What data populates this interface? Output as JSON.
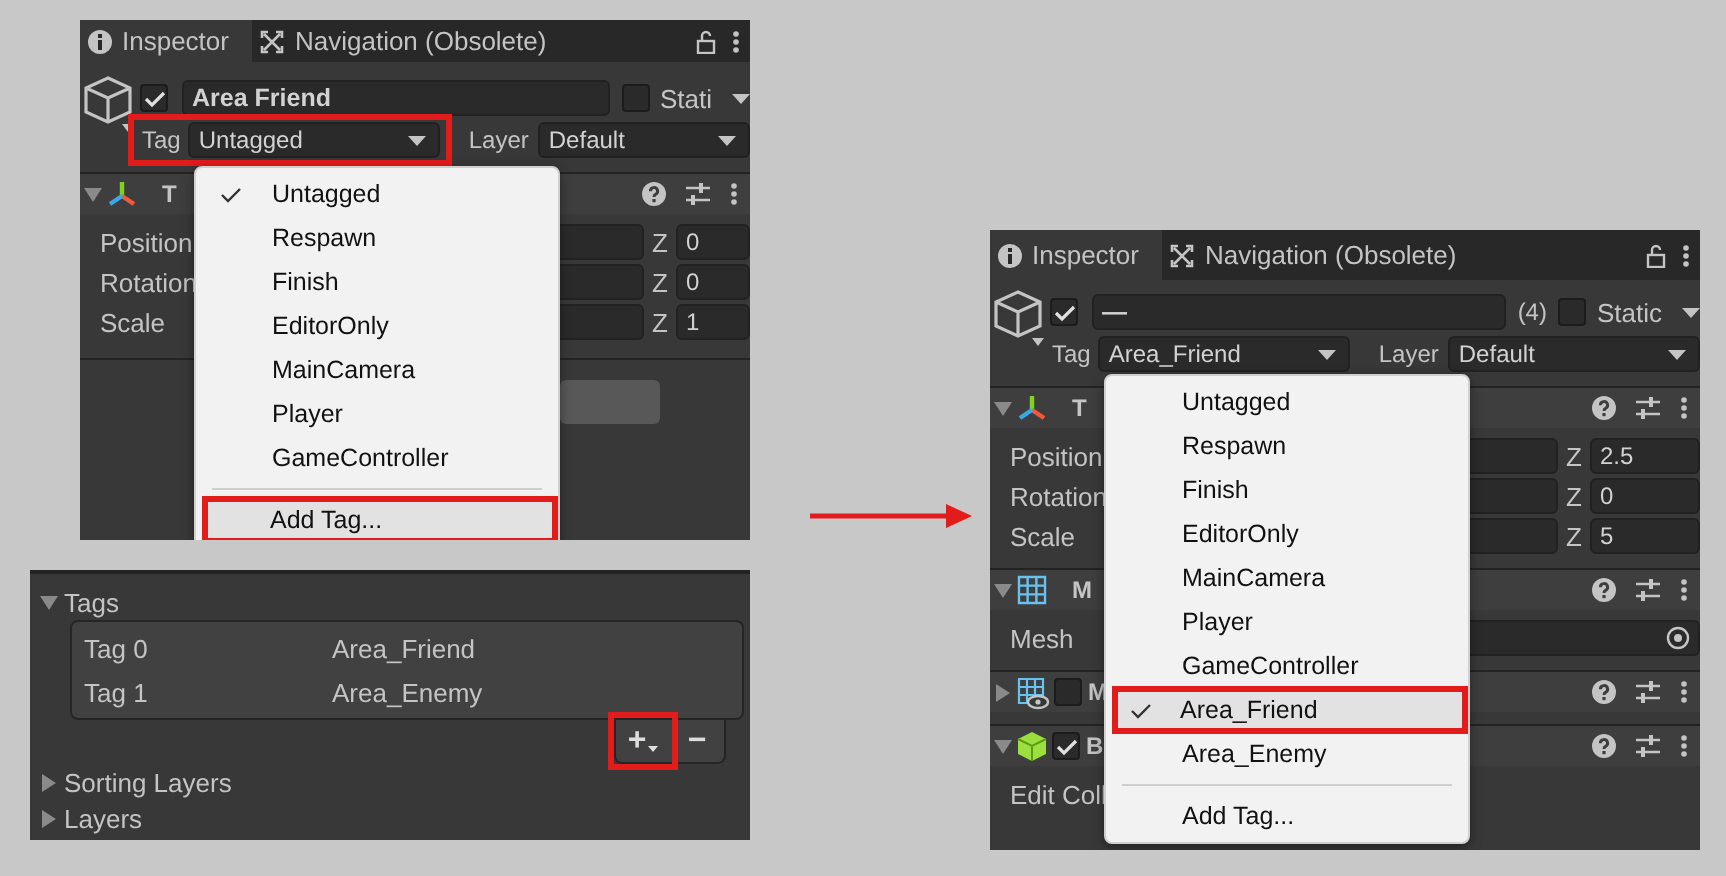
{
  "left_inspector": {
    "tabs": [
      {
        "label": "Inspector",
        "selected": true
      },
      {
        "label": "Navigation (Obsolete)",
        "selected": false
      }
    ],
    "object": {
      "active": true,
      "name": "Area Friend",
      "static": false,
      "static_label": "Stati"
    },
    "tag": {
      "label": "Tag",
      "value": "Untagged",
      "marked": true
    },
    "layer": {
      "label": "Layer",
      "value": "Default"
    },
    "components": [
      {
        "kind": "transform",
        "title": "T",
        "expanded": true
      },
      {
        "kind": "vector",
        "label": "Position",
        "axis": "Z",
        "value": "0"
      },
      {
        "kind": "vector",
        "label": "Rotation",
        "axis": "Z",
        "value": "0"
      },
      {
        "kind": "vector",
        "label": "Scale",
        "axis": "Z",
        "value": "1"
      },
      {
        "kind": "button"
      }
    ],
    "tag_menu": {
      "items": [
        {
          "label": "Untagged",
          "checked": true,
          "marked": false
        },
        {
          "label": "Respawn",
          "checked": false,
          "marked": false
        },
        {
          "label": "Finish",
          "checked": false,
          "marked": false
        },
        {
          "label": "EditorOnly",
          "checked": false,
          "marked": false
        },
        {
          "label": "MainCamera",
          "checked": false,
          "marked": false
        },
        {
          "label": "Player",
          "checked": false,
          "marked": false
        },
        {
          "label": "GameController",
          "checked": false,
          "marked": false
        }
      ],
      "add_label": "Add Tag...",
      "add_marked": true
    }
  },
  "tags_panel": {
    "title": "Tags",
    "expanded": true,
    "rows": [
      {
        "label": "Tag 0",
        "value": "Area_Friend"
      },
      {
        "label": "Tag 1",
        "value": "Area_Enemy"
      }
    ],
    "add_label": "+",
    "remove_label": "−",
    "add_marked": true,
    "sections": [
      {
        "title": "Sorting Layers",
        "expanded": false
      },
      {
        "title": "Layers",
        "expanded": false
      }
    ]
  },
  "right_inspector": {
    "tabs": [
      {
        "label": "Inspector",
        "selected": true
      },
      {
        "label": "Navigation (Obsolete)",
        "selected": false
      }
    ],
    "object": {
      "active": true,
      "name": "—",
      "count": "(4)",
      "static": false,
      "static_label": "Static"
    },
    "tag": {
      "label": "Tag",
      "value": "Area_Friend",
      "marked": false
    },
    "layer": {
      "label": "Layer",
      "value": "Default"
    },
    "components": [
      {
        "kind": "transform",
        "title": "T",
        "expanded": true
      },
      {
        "kind": "vector",
        "label": "Position",
        "axis": "Z",
        "value": "2.5"
      },
      {
        "kind": "vector",
        "label": "Rotation",
        "axis": "Z",
        "value": "0"
      },
      {
        "kind": "vector",
        "label": "Scale",
        "axis": "Z",
        "value": "5"
      },
      {
        "kind": "mesh",
        "title": "M",
        "expanded": true
      },
      {
        "kind": "object",
        "label": "Mesh"
      },
      {
        "kind": "renderer",
        "title": "M",
        "expanded": false,
        "enabled": false
      },
      {
        "kind": "collider",
        "title": "B",
        "expanded": true,
        "enabled": true
      },
      {
        "kind": "label",
        "label": "Edit Coll"
      }
    ],
    "tag_menu": {
      "items": [
        {
          "label": "Untagged",
          "checked": false,
          "marked": false
        },
        {
          "label": "Respawn",
          "checked": false,
          "marked": false
        },
        {
          "label": "Finish",
          "checked": false,
          "marked": false
        },
        {
          "label": "EditorOnly",
          "checked": false,
          "marked": false
        },
        {
          "label": "MainCamera",
          "checked": false,
          "marked": false
        },
        {
          "label": "Player",
          "checked": false,
          "marked": false
        },
        {
          "label": "GameController",
          "checked": false,
          "marked": false
        },
        {
          "label": "Area_Friend",
          "checked": true,
          "marked": true
        },
        {
          "label": "Area_Enemy",
          "checked": false,
          "marked": false
        }
      ],
      "add_label": "Add Tag...",
      "add_marked": false
    }
  }
}
